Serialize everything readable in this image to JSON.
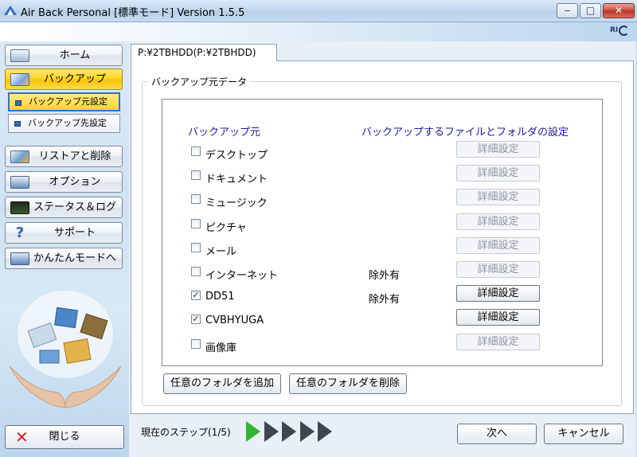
{
  "window": {
    "title": "Air Back Personal [標準モード] Version 1.5.5",
    "minimize": "‒",
    "maximize": "□",
    "close": "✕",
    "brand": "RI"
  },
  "sidebar": {
    "items": [
      {
        "label": "ホーム",
        "icon": "home-icon"
      },
      {
        "label": "バックアップ",
        "icon": "backup-icon",
        "active": true
      },
      {
        "label": "リストアと削除",
        "icon": "restore-icon"
      },
      {
        "label": "オプション",
        "icon": "options-icon"
      },
      {
        "label": "ステータス＆ログ",
        "icon": "status-log-icon"
      },
      {
        "label": "サポート",
        "icon": "support-icon"
      },
      {
        "label": "かんたんモードへ",
        "icon": "easy-mode-icon"
      }
    ],
    "subitems": [
      {
        "label": "バックアップ元設定",
        "active": true
      },
      {
        "label": "バックアップ先設定"
      }
    ],
    "close_label": "閉じる"
  },
  "tab": {
    "label": "P:¥2TBHDD(P:¥2TBHDD)"
  },
  "group": {
    "title": "バックアップ元データ",
    "col_source": "バックアップ元",
    "col_settings": "バックアップするファイルとフォルダの設定",
    "detail_label": "詳細設定",
    "rows": [
      {
        "label": "デスクトップ",
        "checked": false,
        "exclusion": "",
        "detail_enabled": false
      },
      {
        "label": "ドキュメント",
        "checked": false,
        "exclusion": "",
        "detail_enabled": false
      },
      {
        "label": "ミュージック",
        "checked": false,
        "exclusion": "",
        "detail_enabled": false
      },
      {
        "label": "ピクチャ",
        "checked": false,
        "exclusion": "",
        "detail_enabled": false
      },
      {
        "label": "メール",
        "checked": false,
        "exclusion": "",
        "detail_enabled": false
      },
      {
        "label": "インターネット",
        "checked": false,
        "exclusion": "除外有",
        "detail_enabled": false
      },
      {
        "label": "DD51",
        "checked": true,
        "exclusion": "除外有",
        "detail_enabled": true
      },
      {
        "label": "CVBHYUGA",
        "checked": true,
        "exclusion": "",
        "detail_enabled": true
      },
      {
        "label": "画像庫",
        "checked": false,
        "exclusion": "",
        "detail_enabled": false
      }
    ],
    "add_folder": "任意のフォルダを追加",
    "remove_folder": "任意のフォルダを削除"
  },
  "footer": {
    "step_text": "現在のステップ(1/5)",
    "current_step": 1,
    "total_steps": 5,
    "next": "次へ",
    "cancel": "キャンセル"
  },
  "colors": {
    "accent": "#ffd31c",
    "step_current": "#2fb52f",
    "step_pending": "#3e4450"
  }
}
